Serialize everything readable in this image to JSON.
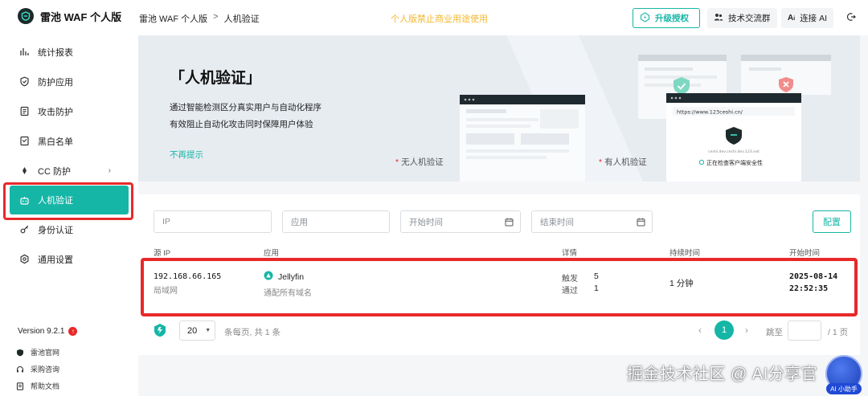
{
  "brand": {
    "name": "雷池 WAF 个人版"
  },
  "sidebar": {
    "items": [
      {
        "label": "统计报表",
        "icon": "bar-chart-icon"
      },
      {
        "label": "防护应用",
        "icon": "shield-icon"
      },
      {
        "label": "攻击防护",
        "icon": "document-icon"
      },
      {
        "label": "黑白名单",
        "icon": "list-icon"
      },
      {
        "label": "CC 防护",
        "icon": "cc-icon",
        "has_submenu": true
      },
      {
        "label": "人机验证",
        "icon": "robot-icon",
        "active": true
      },
      {
        "label": "身份认证",
        "icon": "key-icon"
      },
      {
        "label": "通用设置",
        "icon": "settings-icon"
      }
    ],
    "version": "Version 9.2.1",
    "version_badge": "↑",
    "footer_links": [
      {
        "label": "雷池官网",
        "icon": "shield-logo-icon"
      },
      {
        "label": "采购咨询",
        "icon": "headset-icon"
      },
      {
        "label": "帮助文档",
        "icon": "doc-icon"
      }
    ]
  },
  "header": {
    "breadcrumb": [
      "雷池 WAF 个人版",
      "人机验证"
    ],
    "breadcrumb_sep": ">",
    "notice": "个人版禁止商业用途使用",
    "upgrade_label": "升级授权",
    "group_label": "技术交流群",
    "ai_label": "连接 AI"
  },
  "banner": {
    "title": "「人机验证」",
    "desc_line1": "通过智能检测区分真实用户与自动化程序",
    "desc_line2": "有效阻止自动化攻击同时保障用户体验",
    "dismiss": "不再提示",
    "label_without": "无人机验证",
    "label_with": "有人机验证",
    "mock_url": "https://www.123ceshi.cn/",
    "mock_domain": "ceshi.dev.ceshi.dev.123.net",
    "mock_status": "正在检查客户端安全性"
  },
  "filters": {
    "ip_placeholder": "IP",
    "app_placeholder": "应用",
    "start_placeholder": "开始时间",
    "end_placeholder": "结束时间",
    "config_label": "配置"
  },
  "table": {
    "headers": {
      "source_ip": "源 IP",
      "app": "应用",
      "detail": "详情",
      "duration": "持续时间",
      "start_time": "开始时间"
    },
    "rows": [
      {
        "ip": "192.168.66.165",
        "network": "局域网",
        "app_name": "Jellyfin",
        "app_domain": "通配所有域名",
        "trigger_label": "触发",
        "trigger_count": "5",
        "pass_label": "通过",
        "pass_count": "1",
        "duration": "1 分钟",
        "start_date": "2025-08-14",
        "start_time": "22:52:35"
      }
    ]
  },
  "pagination": {
    "page_size": "20",
    "info": "条每页, 共 1 条",
    "current_page": "1",
    "jump_label": "跳至",
    "total_pages": "/ 1 页"
  },
  "watermark": "掘金技术社区 @ AI分享官",
  "ai_helper_label": "AI 小助手",
  "colors": {
    "accent": "#16b6a7",
    "highlight": "#e8292a",
    "notice": "#f5b82e"
  }
}
